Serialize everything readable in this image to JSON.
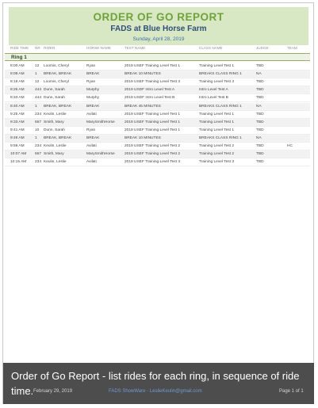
{
  "report": {
    "title": "ORDER OF GO REPORT",
    "subtitle": "FADS at Blue Horse Farm",
    "date": "Sunday, April 28, 2019"
  },
  "columns": [
    "RIDE TIME",
    "NR",
    "RIDER",
    "HORSE NAME",
    "TEST NAME",
    "CLASS NAME",
    "JUDGE",
    "TEAM"
  ],
  "ring": "Ring 1",
  "rows": [
    [
      "8:00 AM",
      "12",
      "Loomis, Cheryl",
      "Ryan",
      "2019 USEF Training Level Test 1",
      "Training Level Test 1",
      "TBD",
      ""
    ],
    [
      "8:08 AM",
      "1",
      "BREAK, BREAK",
      "BREAK",
      "BREAK 10 MINUTES",
      "BREAKS CLASS RING 1",
      "NA",
      ""
    ],
    [
      "8:18 AM",
      "12",
      "Loomis, Cheryl",
      "Ryan",
      "2019 USEF Training Level Test 3",
      "Training Level Test 3",
      "TBD",
      ""
    ],
    [
      "8:26 AM",
      "444",
      "Dunn, Sarah",
      "Murphy",
      "2019 USDF Intro Level Test A",
      "Intro Level Test A",
      "TBD",
      ""
    ],
    [
      "8:33 AM",
      "444",
      "Dunn, Sarah",
      "Murphy",
      "2019 USDF Intro Level Test B",
      "Intro Level Test B",
      "TBD",
      ""
    ],
    [
      "8:40 AM",
      "1",
      "BREAK, BREAK",
      "BREAK",
      "BREAK 45 MINUTES",
      "BREAKS CLASS RING 1",
      "NA",
      ""
    ],
    [
      "9:25 AM",
      "234",
      "Keulin, Leslie",
      "Avilati",
      "2019 USEF Training Level Test 1",
      "Training Level Test 1",
      "TBD",
      ""
    ],
    [
      "9:33 AM",
      "567",
      "Smith, Mary",
      "MarySmithHorse",
      "2019 USEF Training Level Test 1",
      "Training Level Test 1",
      "TBD",
      ""
    ],
    [
      "9:41 AM",
      "10",
      "Dunn, Sarah",
      "Ryan",
      "2019 USEF Training Level Test 1",
      "Training Level Test 1",
      "TBD",
      ""
    ],
    [
      "9:49 AM",
      "1",
      "BREAK, BREAK",
      "BREAK",
      "BREAK 10 MINUTES",
      "BREAKS CLASS RING 1",
      "NA",
      ""
    ],
    [
      "9:59 AM",
      "234",
      "Keulin, Leslie",
      "Avilati",
      "2019 USEF Training Level Test 2",
      "Training Level Test 2",
      "TBD",
      "HC"
    ],
    [
      "10:07 AM",
      "567",
      "Smith, Mary",
      "MarySmithHorse",
      "2019 USEF Training Level Test 2",
      "Training Level Test 2",
      "TBD",
      ""
    ],
    [
      "10:15 AM",
      "234",
      "Keulin, Leslie",
      "Avilati",
      "2019 USEF Training Level Test 3",
      "Training Level Test 3",
      "TBD",
      ""
    ]
  ],
  "footer": {
    "date": "February 29, 2019",
    "center": "FADS ShowWare - LeslieKeulin@gmail.com",
    "page": "Page 1 of 1"
  },
  "caption": "Order of Go Report - list rides for each ring, in sequence of ride time."
}
